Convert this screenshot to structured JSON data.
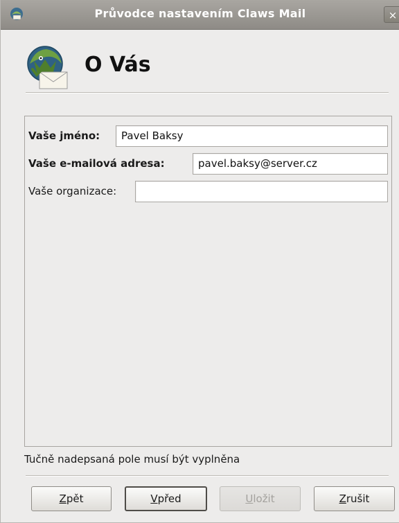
{
  "window": {
    "title": "Průvodce nastavením Claws Mail",
    "close_glyph": "×"
  },
  "header": {
    "title": "O Vás",
    "icon": "claws-mail-logo"
  },
  "form": {
    "name_label": "Vaše jméno:",
    "name_value": "Pavel Baksy",
    "email_label": "Vaše e-mailová adresa:",
    "email_value": "pavel.baksy@server.cz",
    "org_label": "Vaše organizace:",
    "org_value": ""
  },
  "hint": "Tučně nadepsaná pole musí být vyplněna",
  "buttons": {
    "back": {
      "mnemonic": "Z",
      "rest": "pět",
      "enabled": true
    },
    "next": {
      "mnemonic": "V",
      "rest": "před",
      "enabled": true,
      "focused": true
    },
    "save": {
      "mnemonic": "U",
      "rest": "ložit",
      "enabled": false
    },
    "cancel": {
      "mnemonic": "Z",
      "rest": "rušit",
      "enabled": true
    }
  }
}
